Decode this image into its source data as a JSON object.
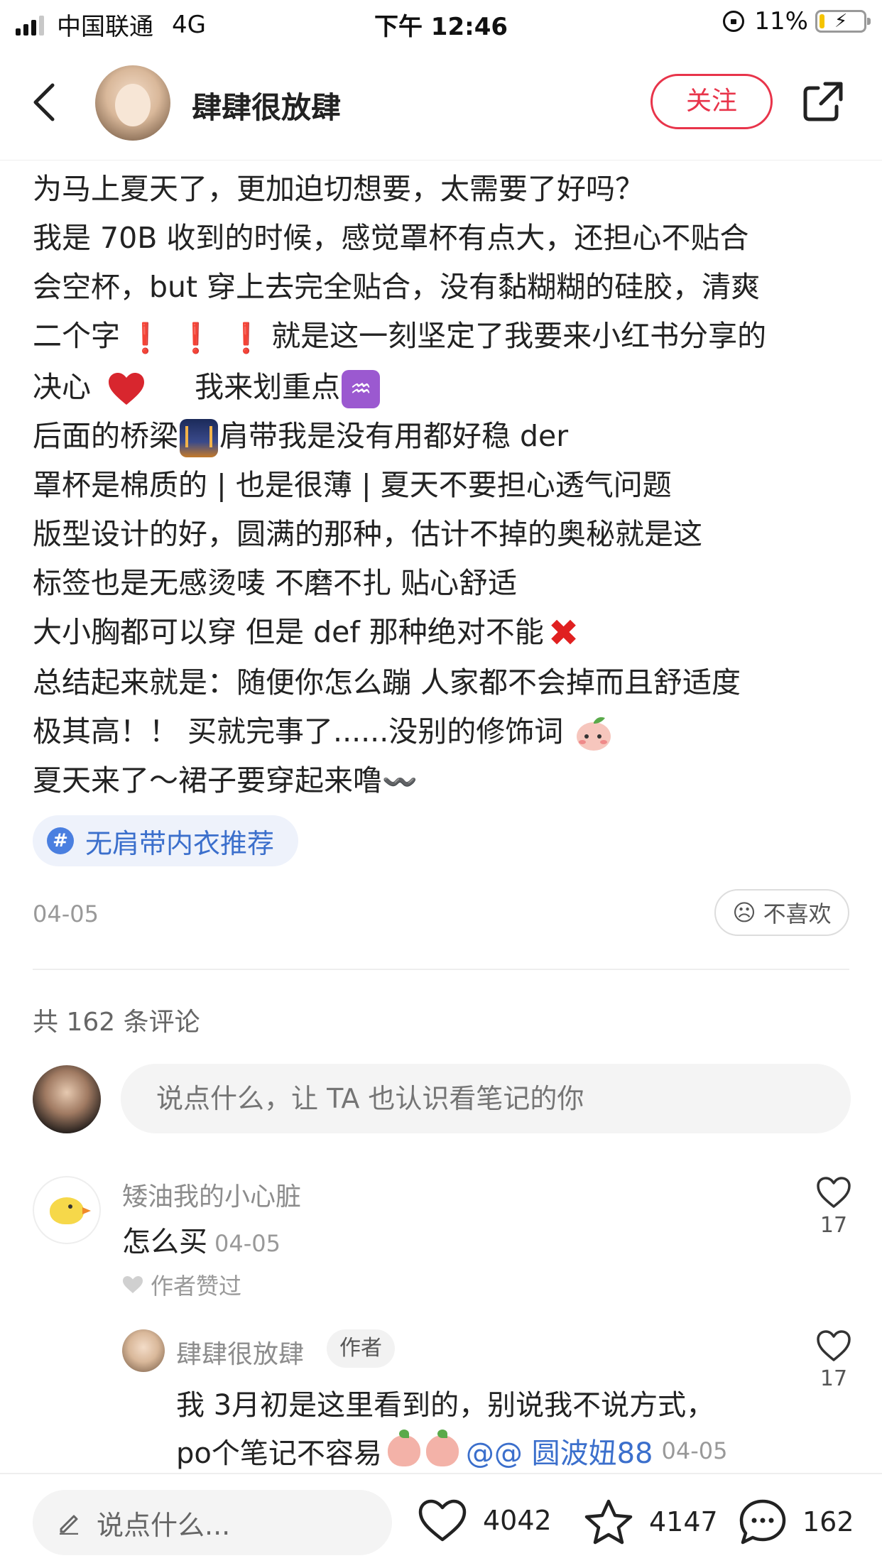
{
  "status_bar": {
    "carrier": "中国联通",
    "network": "4G",
    "time": "下午 12:46",
    "battery_percent": "11%",
    "battery_level": 0.11
  },
  "header": {
    "username": "肆肆很放肆",
    "follow_label": "关注",
    "icons": {
      "back": "chevron-left-icon",
      "share": "share-icon"
    }
  },
  "post": {
    "lines": {
      "l1": "为马上夏天了，更加迫切想要，太需要了好吗？",
      "l2": "我是 70B 收到的时候，感觉罩杯有点大，还担心不贴合",
      "l3": "会空杯，but 穿上去完全贴合，没有黏糊糊的硅胶，清爽",
      "l4a": "二个字",
      "l4b": "就是这一刻坚定了我要来小红书分享的",
      "l5a": "决心",
      "l5b": "我来划重点",
      "l6a": "后面的桥梁",
      "l6b": "肩带我是没有用都好稳 der",
      "l7": "罩杯是棉质的 | 也是很薄 | 夏天不要担心透气问题",
      "l8": "版型设计的好，圆满的那种，估计不掉的奥秘就是这",
      "l9": "标签也是无感烫唛 不磨不扎 贴心舒适",
      "l10a": "大小胸都可以穿 但是 def 那种绝对不能",
      "l11": "总结起来就是：随便你怎么蹦 人家都不会掉而且舒适度",
      "l12a": "极其高！！ 买就完事了......没别的修饰词",
      "l13a": "夏天来了～裙子要穿起来噜"
    },
    "emoji": {
      "exclaim": "❗",
      "aquarius": "♒",
      "cross": "✖",
      "wave": "〰️"
    },
    "hashtag": "无肩带内衣推荐",
    "hashtag_symbol": "#",
    "date": "04-05",
    "dislike_label": "不喜欢",
    "dislike_face": "☹"
  },
  "comments": {
    "count_label": "共 162 条评论",
    "input_placeholder": "说点什么，让 TA 也认识看笔记的你",
    "items": [
      {
        "user": "矮油我的小心脏",
        "text": "怎么买",
        "date": "04-05",
        "liked_by_author": "作者赞过",
        "likes": "17",
        "replies": [
          {
            "user": "肆肆很放肆",
            "badge": "作者",
            "line1": "我 3月初是这里看到的，别说我不说方式，",
            "line2": "po个笔记不容易",
            "mention": "@@ 圆波妞88",
            "date": "04-05",
            "likes": "17"
          }
        ]
      }
    ]
  },
  "bottom_bar": {
    "input_placeholder": "说点什么...",
    "likes": "4042",
    "collects": "4147",
    "comments": "162"
  },
  "colors": {
    "accent_red": "#e8344a",
    "link_blue": "#3b6fcc",
    "muted": "#999999"
  }
}
